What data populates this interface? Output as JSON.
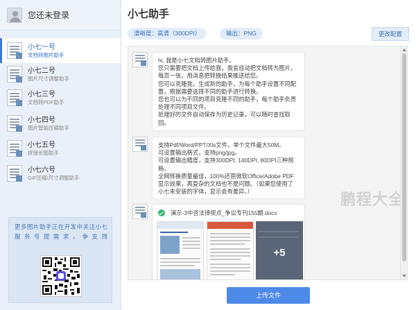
{
  "sidebar": {
    "user_name": "您还未登录",
    "items": [
      {
        "title": "小七一号",
        "sub": "文档转图片助手",
        "active": true
      },
      {
        "title": "小七二号",
        "sub": "图片尺寸调整助手",
        "active": false
      },
      {
        "title": "小七三号",
        "sub": "文档转PDF助手",
        "active": false
      },
      {
        "title": "小七四号",
        "sub": "图片智能压缩助手",
        "active": false
      },
      {
        "title": "小七五号",
        "sub": "拼接长图助手",
        "active": false
      },
      {
        "title": "小七六号",
        "sub": "GIF压缩/尺寸调整助手",
        "active": false
      }
    ],
    "promo_text": "更多图片助手正在开发中关注小七服务号提需求，争支持"
  },
  "main": {
    "title": "小七助手",
    "chips": {
      "quality": "清晰度：高清（300DPI）",
      "format": "输出：PNG"
    },
    "change_config_label": "更改配置",
    "messages": [
      "hi, 我是小七文档转图片助手。\n您只需要把文档上传给我，我会自动把文档转为图片，每页一张，用消息把转换结果推送给您。\n您可以克隆我，生成新的助手，为每个助手设置不同配置，根据需要选择不同的助手进行转换。\n您也可以为不同的项目克隆不同的助手，每个助手负责处理不同项目文件。\n处理好的文件自动保存为历史记录，可以随时查找取回。",
      "支持Pdf/Word/PPT/Xls文件，单个文件最大50M。\n可设置输出格式，支持png/jpg。\n可设置输出精度，支持300DPI, 140DPI, 80DPI三种规格。\n全网转换质量最佳，100%还原微软Office/Adobe PDF显示效果，再复杂的文档也不是问题。（如果您使用了小七未安装的字体，显示会有差异。）"
    ],
    "file": {
      "name": "演示-3中咨法律视点_争讼专刊155期.docx",
      "more": "+5"
    },
    "watermark": "鹏程大全",
    "upload_label": "上传文件"
  },
  "colors": {
    "accent": "#4d8ae8",
    "sidebar_bg": "#e9f0f9",
    "chip_bg": "#e3edfa"
  }
}
